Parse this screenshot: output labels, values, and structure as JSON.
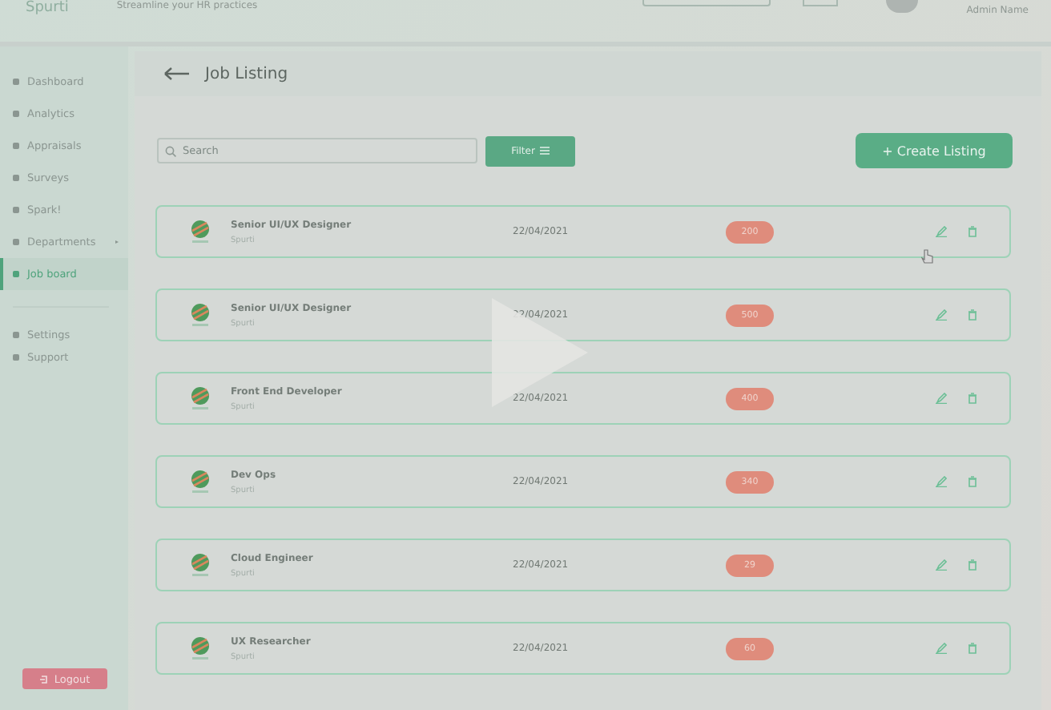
{
  "header": {
    "logo": "Spurti",
    "tagline": "Streamline your HR practices",
    "user": "Admin Name"
  },
  "sidebar": {
    "items": [
      {
        "label": "Dashboard",
        "selected": false,
        "expandable": false
      },
      {
        "label": "Analytics",
        "selected": false,
        "expandable": false
      },
      {
        "label": "Appraisals",
        "selected": false,
        "expandable": false
      },
      {
        "label": "Surveys",
        "selected": false,
        "expandable": false
      },
      {
        "label": "Spark!",
        "selected": false,
        "expandable": false
      },
      {
        "label": "Departments",
        "selected": false,
        "expandable": true
      },
      {
        "label": "Job board",
        "selected": true,
        "expandable": false
      }
    ],
    "footer_items": [
      {
        "label": "Settings"
      },
      {
        "label": "Support"
      }
    ],
    "logout": "Logout"
  },
  "page": {
    "title": "Job Listing",
    "search": {
      "placeholder": "Search"
    },
    "filter": "Filter",
    "create": "+ Create Listing"
  },
  "listings": [
    {
      "title": "Senior UI/UX Designer",
      "company": "Spurti",
      "date": "22/04/2021",
      "count": "200"
    },
    {
      "title": "Senior UI/UX Designer",
      "company": "Spurti",
      "date": "22/04/2021",
      "count": "500"
    },
    {
      "title": "Front End Developer",
      "company": "Spurti",
      "date": "22/04/2021",
      "count": "400"
    },
    {
      "title": "Dev Ops",
      "company": "Spurti",
      "date": "22/04/2021",
      "count": "340"
    },
    {
      "title": "Cloud Engineer",
      "company": "Spurti",
      "date": "22/04/2021",
      "count": "29"
    },
    {
      "title": "UX Researcher",
      "company": "Spurti",
      "date": "22/04/2021",
      "count": "60"
    }
  ]
}
